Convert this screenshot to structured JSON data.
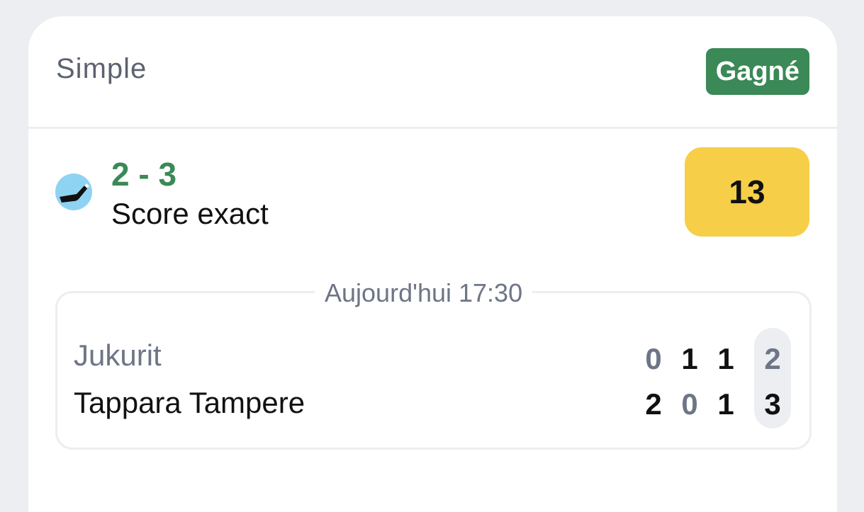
{
  "header": {
    "bet_type": "Simple",
    "status": "Gagné",
    "status_color": "#3a8956"
  },
  "selection": {
    "sport_icon": "hockey-stick-icon",
    "score": "2 - 3",
    "market": "Score exact",
    "odds": "13",
    "odds_color": "#f6ce48"
  },
  "event": {
    "date": "Aujourd'hui 17:30",
    "home_team": "Jukurit",
    "away_team": "Tappara Tampere",
    "home_periods": [
      "0",
      "1",
      "1"
    ],
    "home_total": "2",
    "away_periods": [
      "2",
      "0",
      "1"
    ],
    "away_total": "3"
  }
}
